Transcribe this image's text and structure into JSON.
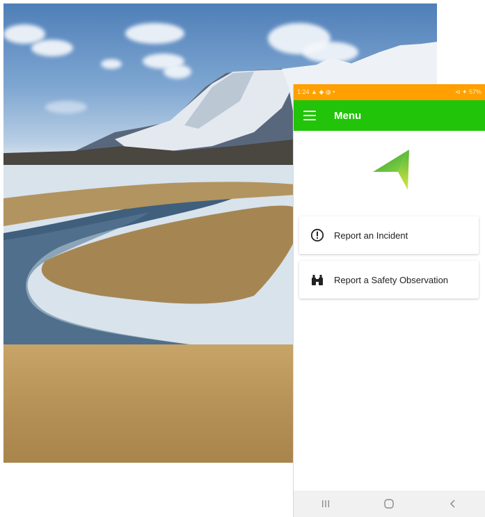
{
  "status_bar": {
    "time": "1:24",
    "notification_icons": "▲ ◆ ◍ •",
    "right_indicators": "⊲ ✦ 57%"
  },
  "app_bar": {
    "menu_icon": "hamburger-icon",
    "title": "Menu"
  },
  "logo": {
    "icon": "arrow-navigation-logo",
    "color": "#5dc43a"
  },
  "menu_items": [
    {
      "label": "Report an Incident",
      "icon": "exclamation-circle-icon"
    },
    {
      "label": "Report a Safety Observation",
      "icon": "binoculars-icon"
    }
  ],
  "nav_bar": {
    "recent_icon": "recent-apps-icon",
    "home_icon": "home-icon",
    "back_icon": "back-icon"
  },
  "colors": {
    "status_bar": "#ffa000",
    "app_bar": "#22c40a",
    "nav_bar": "#f1f1f1"
  }
}
